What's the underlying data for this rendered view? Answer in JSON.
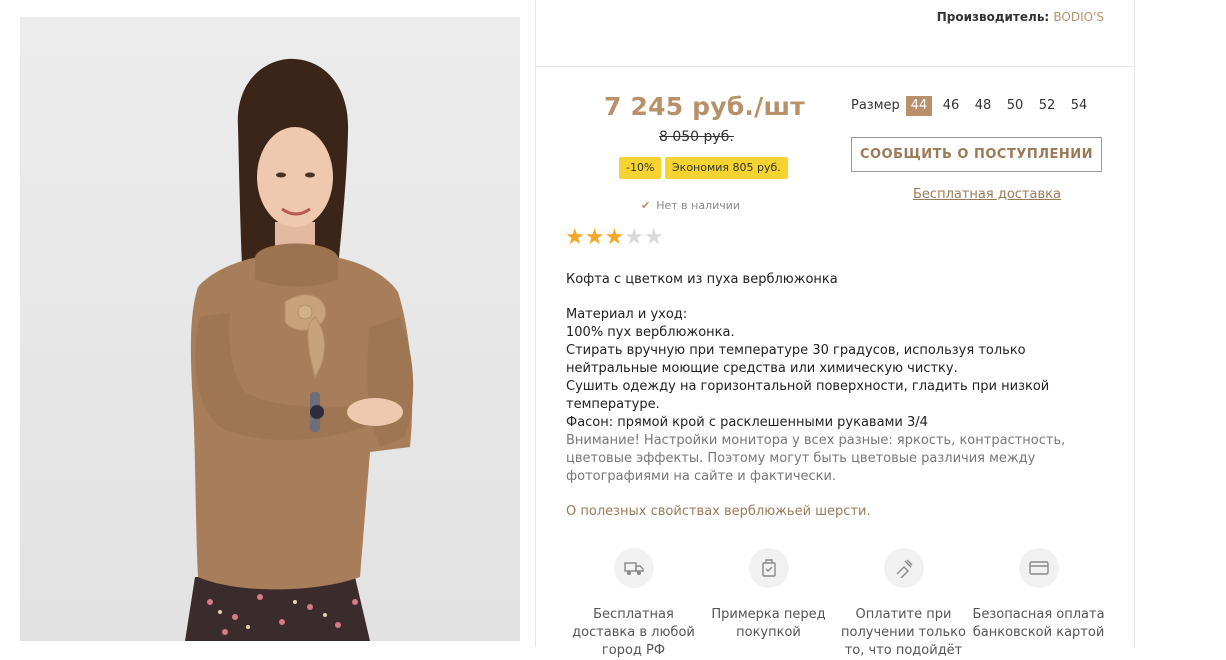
{
  "manufacturer": {
    "label": "Производитель:",
    "brand": "BODIO'S"
  },
  "price": {
    "current": "7 245 руб./шт",
    "old": "8 050 руб.",
    "discount_badge": "-10%",
    "savings_badge": "Экономия 805 руб."
  },
  "stock_status": "Нет в наличии",
  "sizes": {
    "label": "Размер",
    "options": [
      "44",
      "46",
      "48",
      "50",
      "52",
      "54"
    ],
    "selected": "44"
  },
  "notify_button": "СООБЩИТЬ О ПОСТУПЛЕНИИ",
  "free_delivery_link": "Бесплатная доставка",
  "rating": {
    "value": 3,
    "max": 5
  },
  "description": {
    "title": "Кофта с цветком из пуха верблюжонка",
    "lines": [
      "Материал и уход:",
      "100% пух верблюжонка.",
      "Стирать вручную при температуре 30 градусов, используя только нейтральные моющие средства или химическую чистку.",
      "Сушить одежду на горизонтальной поверхности, гладить при низкой температуре.",
      "Фасон: прямой крой с расклешенными рукавами 3/4"
    ],
    "note": "Внимание! Настройки монитора у всех разные: яркость, контрастность, цветовые эффекты. Поэтому могут быть цветовые различия между фотографиями на сайте и фактически.",
    "link": "О полезных свойствах верблюжьей шерсти."
  },
  "features": [
    {
      "icon": "truck-icon",
      "text": "Бесплатная доставка в любой город РФ"
    },
    {
      "icon": "fitting-icon",
      "text": "Примерка перед покупкой"
    },
    {
      "icon": "cash-on-delivery-icon",
      "text": "Оплатите при получении только то, что подойдёт"
    },
    {
      "icon": "card-icon",
      "text": "Безопасная оплата банковской картой"
    }
  ],
  "colors": {
    "accent": "#b8916a",
    "badge": "#f5d330",
    "star": "#f5a623"
  }
}
